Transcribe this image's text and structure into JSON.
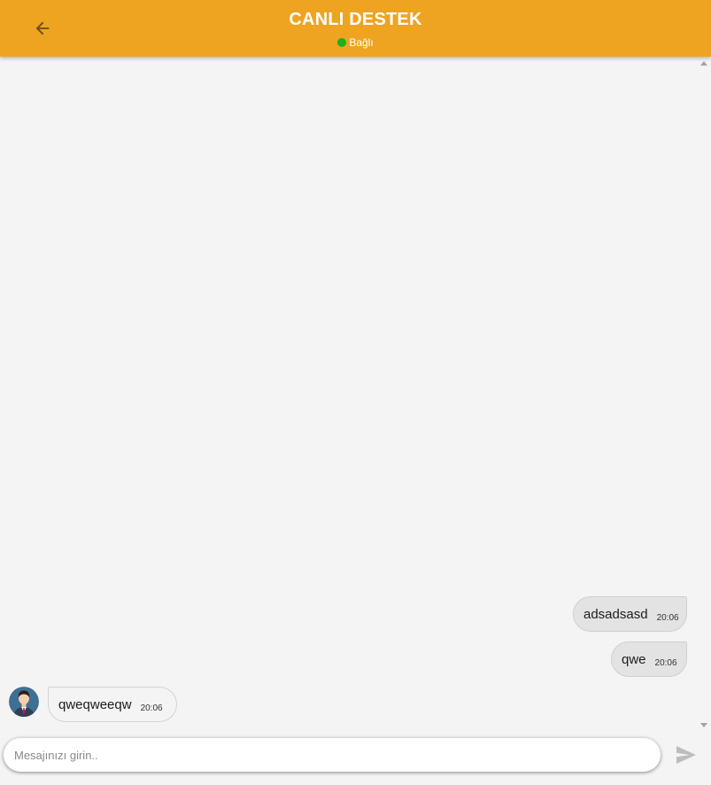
{
  "header": {
    "title": "CANLI DESTEK",
    "status": "Bağlı",
    "status_color": "#19b31a",
    "background_color": "#eea421",
    "back_icon": "arrow-left-icon"
  },
  "messages": [
    {
      "direction": "outgoing",
      "text": "adsadsasd",
      "time": "20:06"
    },
    {
      "direction": "outgoing",
      "text": "qwe",
      "time": "20:06"
    },
    {
      "direction": "incoming",
      "text": "qweqweeqw",
      "time": "20:06",
      "avatar": "agent-avatar"
    }
  ],
  "composer": {
    "placeholder": "Mesajınızı girin..",
    "value": "",
    "send_icon": "send-icon"
  }
}
